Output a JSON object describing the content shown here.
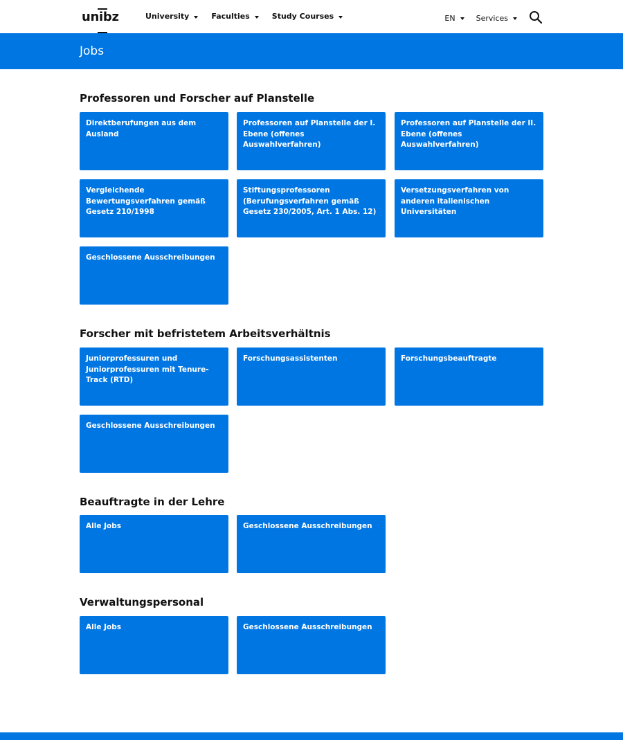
{
  "header": {
    "logo": "unibz",
    "nav": [
      {
        "label": "University"
      },
      {
        "label": "Faculties"
      },
      {
        "label": "Study Courses"
      }
    ],
    "language": "EN",
    "services": "Services"
  },
  "page": {
    "title": "Jobs"
  },
  "sections": [
    {
      "title": "Professoren und Forscher auf Planstelle",
      "tiles": [
        "Direktberufungen aus dem Ausland",
        "Professoren auf Planstelle der I. Ebene (offenes Auswahlverfahren)",
        "Professoren auf Planstelle der II. Ebene (offenes Auswahlverfahren)",
        "Vergleichende Bewertungsverfahren gemäß Gesetz 210/1998",
        "Stiftungsprofessoren (Berufungsverfahren gemäß Gesetz 230/2005, Art. 1 Abs. 12)",
        "Versetzungsverfahren von anderen italienischen Universitäten",
        "Geschlossene Ausschreibungen"
      ]
    },
    {
      "title": "Forscher mit befristetem Arbeitsverhältnis",
      "tiles": [
        "Juniorprofessuren und Juniorprofessuren mit Tenure-Track (RTD)",
        "Forschungsassistenten",
        "Forschungsbeauftragte",
        "Geschlossene Ausschreibungen"
      ]
    },
    {
      "title": "Beauftragte in der Lehre",
      "tiles": [
        "Alle Jobs",
        "Geschlossene Ausschreibungen"
      ]
    },
    {
      "title": "Verwaltungspersonal",
      "tiles": [
        "Alle Jobs",
        "Geschlossene Ausschreibungen"
      ]
    }
  ],
  "colors": {
    "brand_blue": "#0076e3",
    "text": "#111111",
    "background": "#ffffff"
  }
}
